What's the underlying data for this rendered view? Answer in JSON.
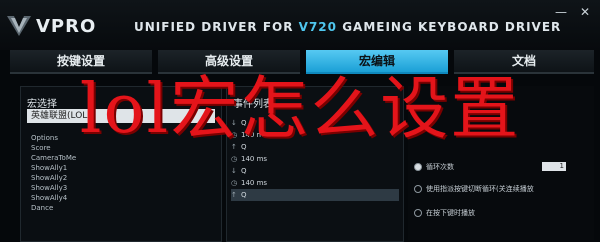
{
  "header": {
    "brand": "VPRO",
    "title_prefix": "UNIFIED DRIVER FOR",
    "title_model": "V720",
    "title_suffix": "GAMEING KEYBOARD DRIVER",
    "minimize_label": "—",
    "close_label": "✕",
    "accent_color": "#4fc6ee"
  },
  "tabs": [
    {
      "label": "按键设置",
      "active": false
    },
    {
      "label": "高级设置",
      "active": false
    },
    {
      "label": "宏编辑",
      "active": true
    },
    {
      "label": "文档",
      "active": false
    }
  ],
  "left_panel": {
    "heading": "宏选择",
    "selected_value": "英雄联盟(LOL)",
    "items": [
      "Options",
      "Score",
      "CameraToMe",
      "ShowAlly1",
      "ShowAlly2",
      "ShowAlly3",
      "ShowAlly4",
      "Dance"
    ]
  },
  "mid_panel": {
    "heading": "事件列表",
    "rows": [
      {
        "icon": "↓",
        "text": "Q"
      },
      {
        "icon": "◷",
        "text": "140 ms"
      },
      {
        "icon": "↑",
        "text": "Q"
      },
      {
        "icon": "◷",
        "text": "140 ms"
      },
      {
        "icon": "↓",
        "text": "Q"
      },
      {
        "icon": "◷",
        "text": "140 ms"
      },
      {
        "icon": "↑",
        "text": "Q"
      }
    ]
  },
  "right_panel": {
    "options": [
      {
        "label": "循环次数",
        "on": true
      },
      {
        "label": "使用指派按键切断循环(关连续播放",
        "on": false
      },
      {
        "label": "在按下键时播放",
        "on": false
      }
    ],
    "loop_count": "1"
  },
  "overlay_text": "lol宏怎么设置"
}
